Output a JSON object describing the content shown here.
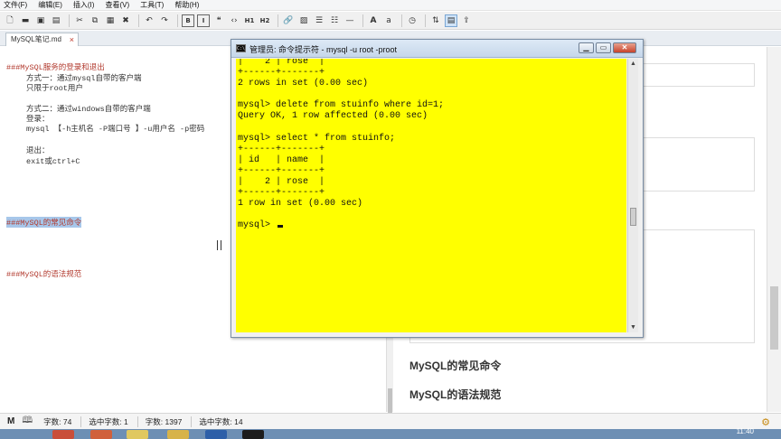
{
  "menu": [
    "文件(F)",
    "编辑(E)",
    "插入(I)",
    "查看(V)",
    "工具(T)",
    "帮助(H)"
  ],
  "toolbar": {
    "icons": [
      "new-file-icon",
      "open-folder-icon",
      "save-icon",
      "save-as-icon",
      "cut-icon",
      "copy-icon",
      "paste-icon",
      "delete-icon",
      "undo-icon",
      "redo-icon",
      "bold-icon",
      "italic-icon",
      "quote-icon",
      "code-icon",
      "h1-icon",
      "h2-icon",
      "link-icon",
      "image-icon",
      "ordered-list-icon",
      "unordered-list-icon",
      "horizontal-rule-icon",
      "font-larger-icon",
      "font-smaller-icon",
      "clock-icon",
      "sync-scroll-icon",
      "preview-icon",
      "export-icon"
    ],
    "labels": {
      "h1": "H1",
      "h2": "H2",
      "font_a_big": "A",
      "font_a_small": "a"
    }
  },
  "tab": {
    "label": "MySQL笔记.md",
    "close": "×"
  },
  "editor": {
    "lines": [
      {
        "text": "###MySQL服务的登录和退出",
        "kind": "heading"
      },
      {
        "text": "方式一：通过mysql自带的客户端",
        "kind": "indent"
      },
      {
        "text": "只限于root用户",
        "kind": "indent"
      },
      {
        "text": "方式二：通过windows自带的客户端",
        "kind": "indent"
      },
      {
        "text": "登录：",
        "kind": "indent"
      },
      {
        "text": "mysql 【-h主机名 -P端口号 】-u用户名 -p密码",
        "kind": "indent"
      },
      {
        "text": "退出：",
        "kind": "indent"
      },
      {
        "text": "exit或ctrl+C",
        "kind": "indent"
      },
      {
        "text": "###MySQL的常见命令",
        "kind": "selected"
      },
      {
        "text": "###MySQL的语法规范",
        "kind": "heading"
      }
    ]
  },
  "preview": {
    "headings": [
      "MySQL的常见命令",
      "MySQL的语法规范"
    ]
  },
  "console": {
    "title": "管理员: 命令提示符 - mysql  -u root -proot",
    "icon_text": "C:\\",
    "buttons": {
      "minimize": "▁",
      "maximize": "▭",
      "close": "✕"
    },
    "lines": [
      "|    2 | rose  |",
      "+------+-------+",
      "2 rows in set (0.00 sec)",
      "",
      "mysql> delete from stuinfo where id=1;",
      "Query OK, 1 row affected (0.00 sec)",
      "",
      "mysql> select * from stuinfo;",
      "+------+-------+",
      "| id   | name  |",
      "+------+-------+",
      "|    2 | rose  |",
      "+------+-------+",
      "1 row in set (0.00 sec)",
      "",
      "mysql> "
    ],
    "bg_color": "#ffff00"
  },
  "status": {
    "chars": "字数: 74",
    "selected_chars": "选中字数: 1",
    "words": "字数: 1397",
    "selected_words": "选中字数: 14"
  },
  "taskbar": {
    "clock": "11:40"
  }
}
